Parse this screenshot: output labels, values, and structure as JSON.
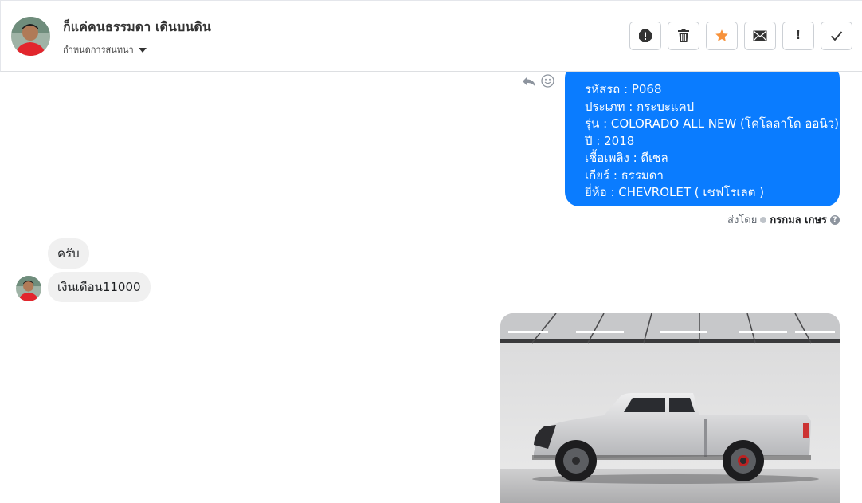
{
  "header": {
    "contact_name": "ก็แค่คนธรรมดา เดินบนดิน",
    "assign_label": "กำหนดการสนทนา",
    "avatar_icon": "profile-photo",
    "actions": [
      {
        "name": "spam-icon"
      },
      {
        "name": "trash-icon"
      },
      {
        "name": "star-icon",
        "color": "#f7923b"
      },
      {
        "name": "mail-icon"
      },
      {
        "name": "follow-up-icon",
        "glyph": "!"
      },
      {
        "name": "done-icon"
      }
    ]
  },
  "thread": {
    "outgoing_card": {
      "lines": [
        "รหัสรถ : P068",
        "ประเภท : กระบะแคป",
        "รุ่น : COLORADO ALL NEW (โคโลลาโด ออนิว)",
        "ปี : 2018",
        "เชื้อเพลิง : ดีเซล",
        "เกียร์ : ธรรมดา",
        "ยี่ห้อ : CHEVROLET ( เชฟโรเลต )"
      ],
      "color": "#0a7cff"
    },
    "sent_by": {
      "prefix": "ส่งโดย",
      "name": "กรกมล เกษร"
    },
    "incoming": [
      {
        "text": "ครับ"
      },
      {
        "text": "เงินเดือน11000"
      }
    ],
    "image_attachment": "pickup-truck-photo"
  }
}
